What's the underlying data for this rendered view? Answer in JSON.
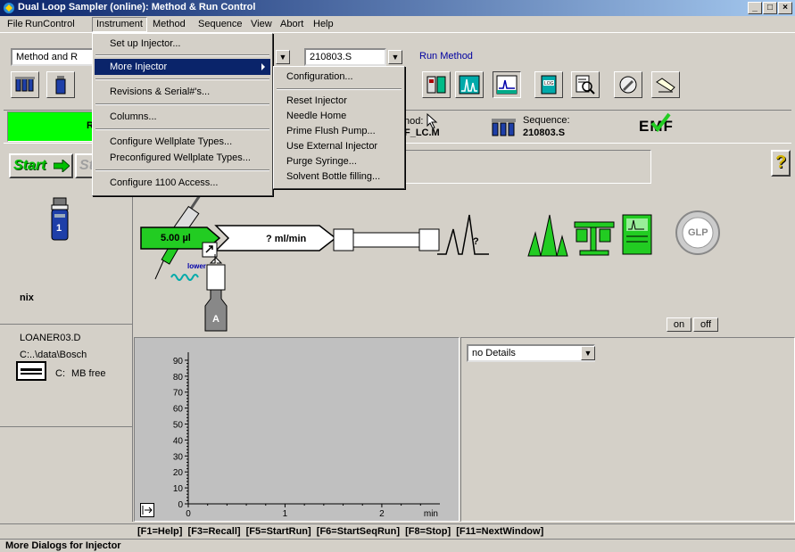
{
  "window": {
    "title": "Dual Loop Sampler (online): Method & Run Control",
    "controls": [
      "_",
      "□",
      "×"
    ]
  },
  "menubar": {
    "items": [
      "File",
      "RunControl",
      "Instrument",
      "Method",
      "Sequence",
      "View",
      "Abort",
      "Help"
    ]
  },
  "toolbar": {
    "view_combo": "Method and R",
    "sequence_combo": "210803.S",
    "run_method_label": "Run Method"
  },
  "instrument_menu": {
    "items": [
      {
        "label": "Set up Injector..."
      },
      {
        "label": "More Injector",
        "highlighted": true,
        "submenu": true
      },
      {
        "label": "Revisions & Serial#'s..."
      },
      {
        "label": "Columns..."
      },
      {
        "label": "Configure Wellplate Types..."
      },
      {
        "label": "Preconfigured Wellplate Types..."
      },
      {
        "label": "Configure 1100 Access..."
      }
    ]
  },
  "more_injector_submenu": {
    "items": [
      "Configuration...",
      "Reset Injector",
      "Needle Home",
      "Prime Flush Pump...",
      "Use External Injector",
      "Purge Syringe...",
      "Solvent Bottle filling..."
    ]
  },
  "status": {
    "ready_text": "Re",
    "method_label": "hod:",
    "method_value": "F_LC.M",
    "sequence_label": "Sequence:",
    "sequence_value": "210803.S",
    "emf_label": "EMF"
  },
  "run_buttons": {
    "start": "Start",
    "stop": "St"
  },
  "help_button": "?",
  "left_panel": {
    "vial_number": "1",
    "sample_name": "nix",
    "data_file": "LOANER03.D",
    "data_path": "C:..\\data\\Bosch",
    "disk_label": "C:",
    "disk_free": "MB free"
  },
  "schematic": {
    "injection_volume": "5.00 µl",
    "flow_rate": "? ml/min",
    "column_unknown": "?",
    "lower_label": "lower",
    "solvent_label": "A",
    "glp_label": "GLP",
    "on_button": "on",
    "off_button": "off"
  },
  "detail_panel": {
    "combo_value": "no Details"
  },
  "chart_data": {
    "type": "line",
    "title": "",
    "xlabel": "min",
    "ylabel": "",
    "xlim": [
      0,
      2.6
    ],
    "ylim": [
      0,
      95
    ],
    "x_ticks": [
      "0",
      "1",
      "2"
    ],
    "y_ticks": [
      "0",
      "10",
      "20",
      "30",
      "40",
      "50",
      "60",
      "70",
      "80",
      "90"
    ],
    "series": []
  },
  "function_keys": "[F1=Help]  [F3=Recall]  [F5=StartRun]  [F6=StartSeqRun]  [F8=Stop]  [F11=NextWindow]",
  "statusbar_text": "More Dialogs for Injector",
  "colors": {
    "title_start": "#0a246a",
    "title_end": "#a6caf0",
    "menu_highlight": "#0a246a",
    "ready_green": "#00ff00",
    "schematic_green": "#22cc22",
    "face": "#d4d0c8"
  }
}
